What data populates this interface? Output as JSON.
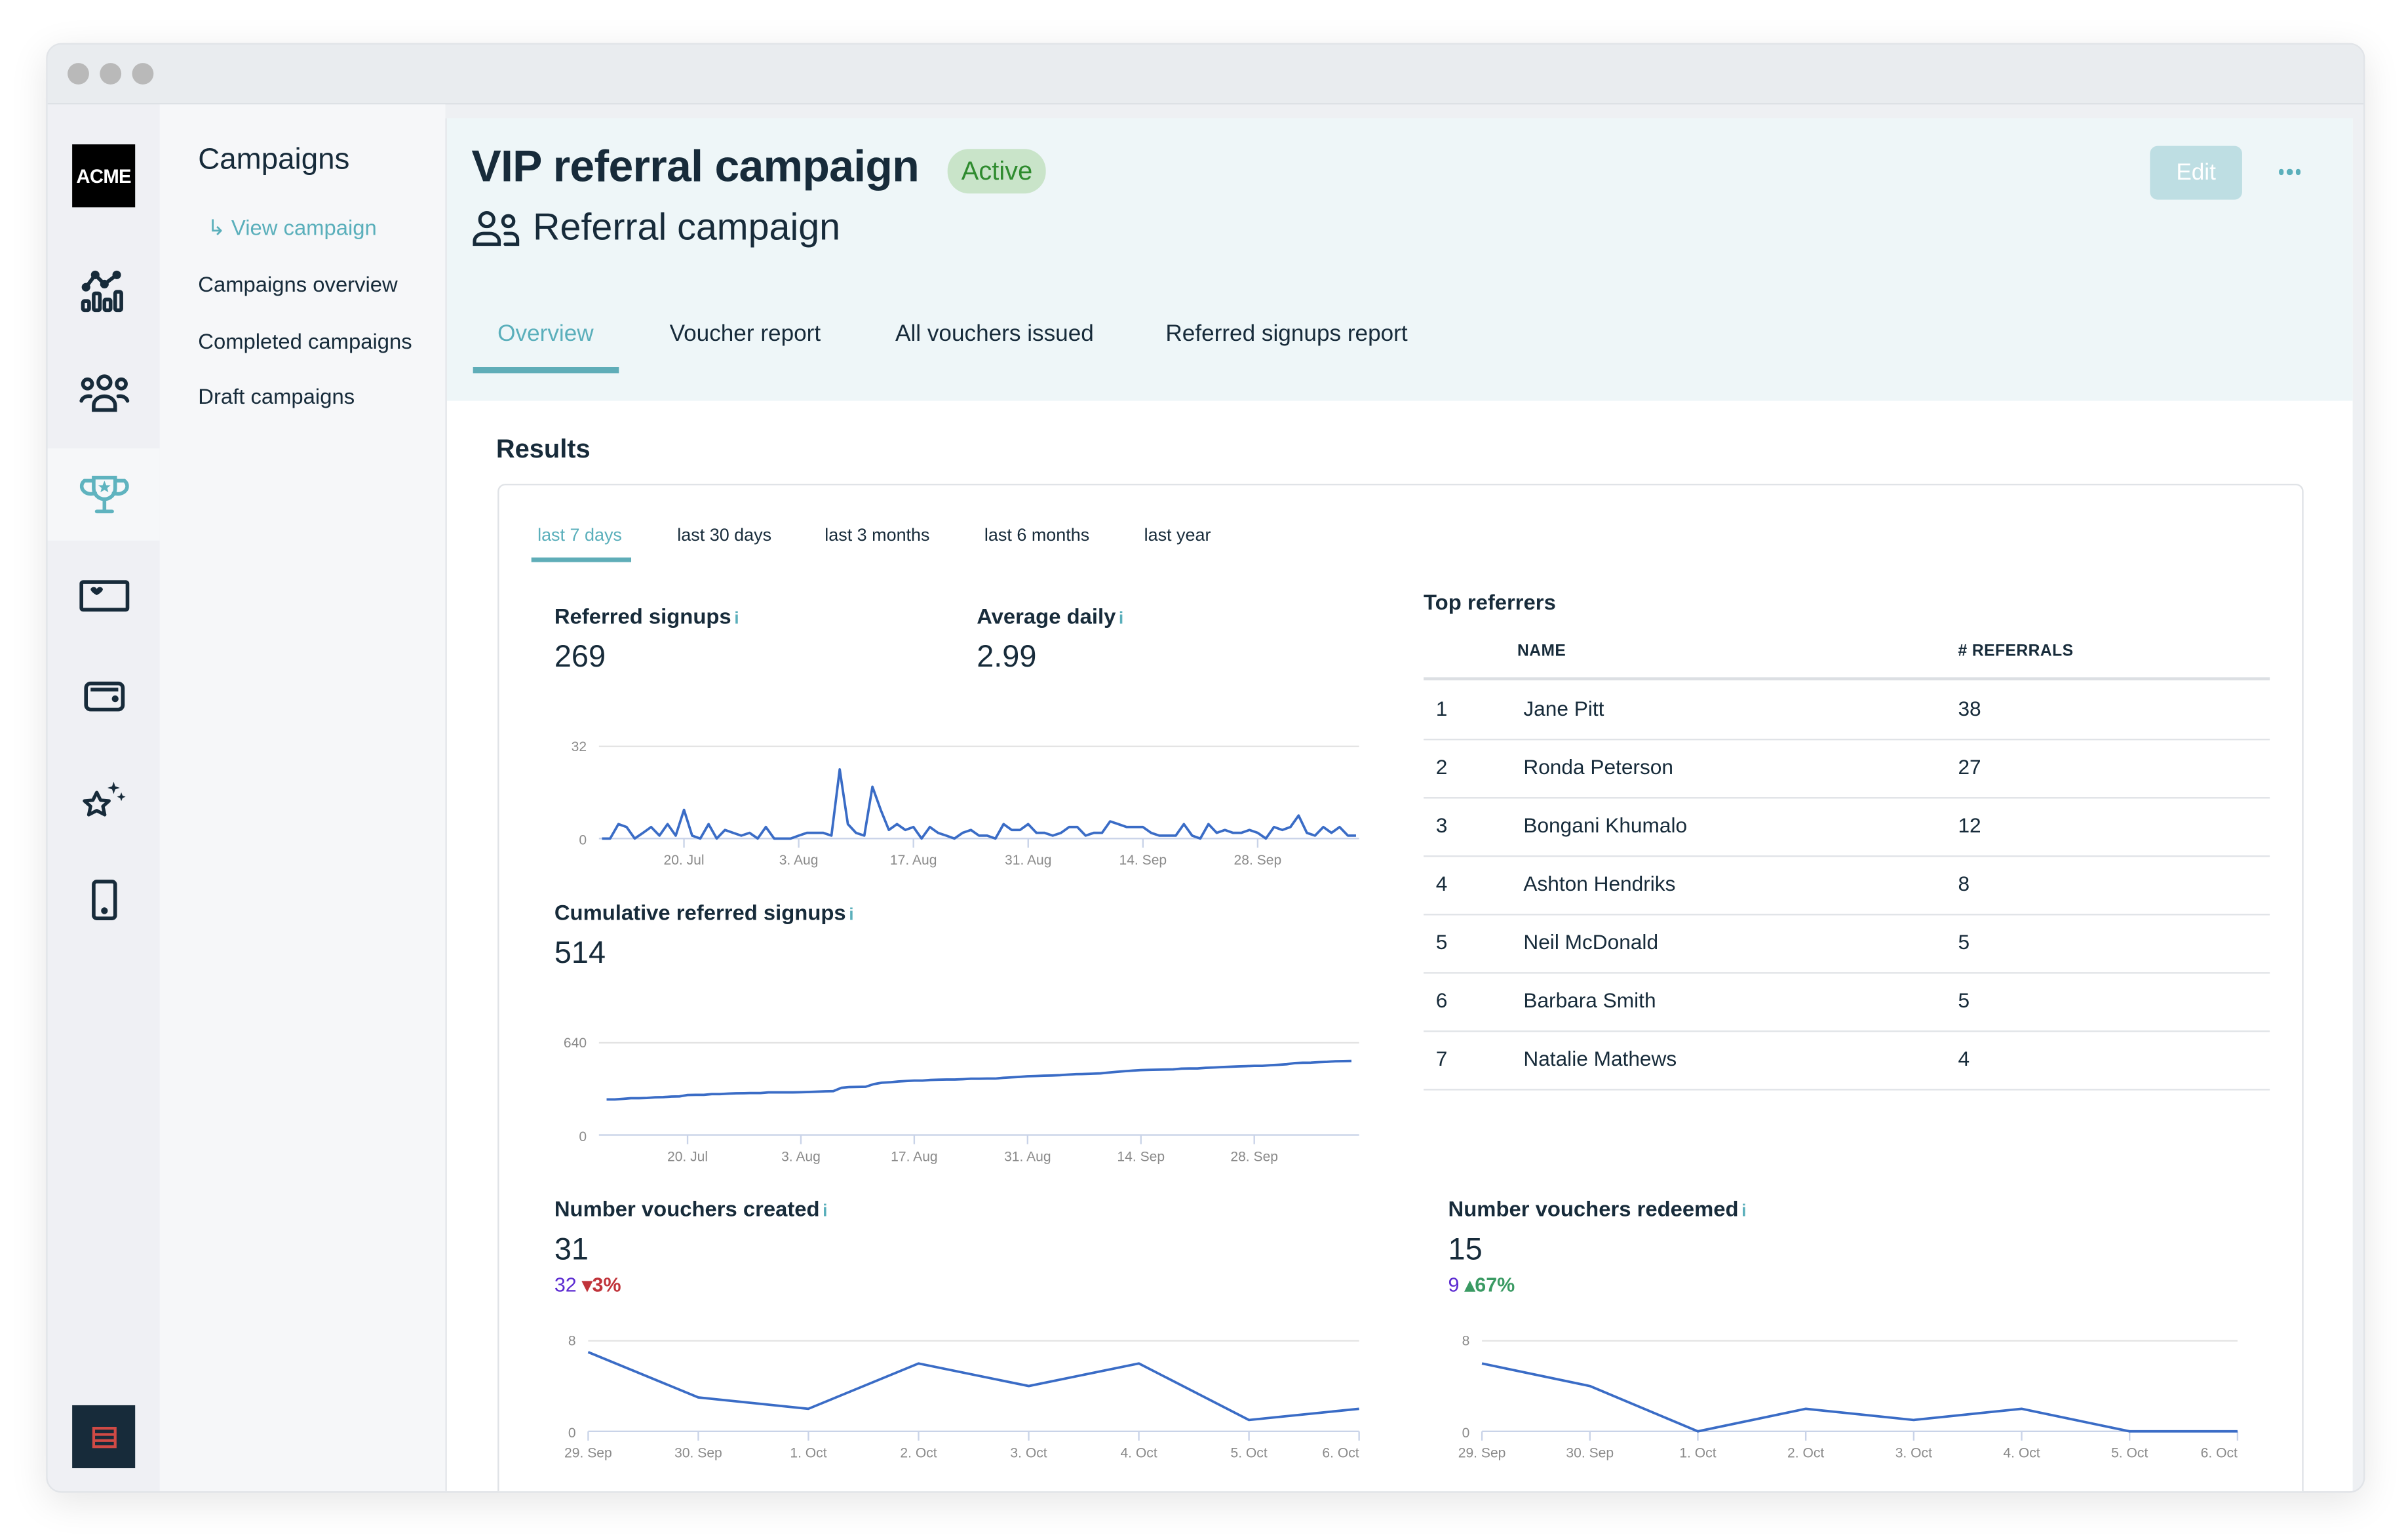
{
  "window": {
    "controls": [
      "close",
      "minimize",
      "maximize"
    ]
  },
  "rail": {
    "logo": "ACME",
    "items": [
      {
        "icon": "analytics-icon",
        "active": false
      },
      {
        "icon": "customers-icon",
        "active": false
      },
      {
        "icon": "trophy-icon",
        "active": true
      },
      {
        "icon": "gift-card-icon",
        "active": false
      },
      {
        "icon": "wallet-icon",
        "active": false
      },
      {
        "icon": "stars-icon",
        "active": false
      },
      {
        "icon": "mobile-icon",
        "active": false
      }
    ],
    "bottom_icon": "menu-icon"
  },
  "subnav": {
    "title": "Campaigns",
    "current": "↳ View campaign",
    "links": [
      "Campaigns overview",
      "Completed campaigns",
      "Draft campaigns"
    ]
  },
  "header": {
    "title": "VIP referral campaign",
    "status": "Active",
    "subtitle": "Referral campaign",
    "edit_label": "Edit",
    "tabs": [
      "Overview",
      "Voucher report",
      "All vouchers issued",
      "Referred signups report"
    ],
    "active_tab": "Overview"
  },
  "results": {
    "heading": "Results",
    "periods": [
      "last 7 days",
      "last 30 days",
      "last 3 months",
      "last 6 months",
      "last year"
    ],
    "active_period": "last 7 days",
    "info_glyph": "i",
    "referred_signups": {
      "label": "Referred signups",
      "value": "269"
    },
    "average_daily": {
      "label": "Average daily",
      "value": "2.99"
    },
    "cumulative": {
      "label": "Cumulative referred signups",
      "value": "514"
    },
    "vouchers_created": {
      "label": "Number vouchers created",
      "value": "31",
      "previous": "32",
      "change": "3%",
      "direction": "down"
    },
    "vouchers_redeemed": {
      "label": "Number vouchers redeemed",
      "value": "15",
      "previous": "9",
      "change": "67%",
      "direction": "up"
    },
    "top_referrers": {
      "title": "Top referrers",
      "columns": [
        "NAME",
        "# REFERRALS"
      ],
      "rows": [
        {
          "rank": "1",
          "name": "Jane Pitt",
          "referrals": "38"
        },
        {
          "rank": "2",
          "name": "Ronda Peterson",
          "referrals": "27"
        },
        {
          "rank": "3",
          "name": "Bongani Khumalo",
          "referrals": "12"
        },
        {
          "rank": "4",
          "name": "Ashton Hendriks",
          "referrals": "8"
        },
        {
          "rank": "5",
          "name": "Neil McDonald",
          "referrals": "5"
        },
        {
          "rank": "6",
          "name": "Barbara Smith",
          "referrals": "5"
        },
        {
          "rank": "7",
          "name": "Natalie Mathews",
          "referrals": "4"
        }
      ]
    }
  },
  "colors": {
    "accent": "#5fadb8",
    "line": "#3a6cc6",
    "active_badge_bg": "#c9e4c9",
    "active_badge_text": "#2e8b2e",
    "down": "#c0333a",
    "up": "#3a9a63",
    "previous": "#5b2ad1"
  },
  "chart_data": [
    {
      "id": "daily_signups",
      "type": "line",
      "title": "Referred signups",
      "xlabel": "",
      "ylabel": "",
      "ylim": [
        0,
        32
      ],
      "yticks": [
        "0",
        "32"
      ],
      "xticks": [
        "20. Jul",
        "3. Aug",
        "17. Aug",
        "31. Aug",
        "14. Sep",
        "28. Sep"
      ],
      "xtick_index": [
        10,
        24,
        38,
        52,
        66,
        80
      ],
      "values": [
        0,
        0,
        5,
        4,
        0,
        2,
        4,
        1,
        5,
        1,
        10,
        1,
        0,
        5,
        0,
        3,
        2,
        1,
        2,
        0,
        4,
        0,
        0,
        0,
        1,
        2,
        2,
        2,
        1,
        24,
        5,
        2,
        1,
        18,
        10,
        3,
        5,
        3,
        4,
        0,
        4,
        2,
        1,
        0,
        2,
        3,
        1,
        1,
        0,
        5,
        3,
        3,
        5,
        2,
        2,
        1,
        2,
        4,
        4,
        1,
        2,
        2,
        6,
        5,
        4,
        4,
        4,
        2,
        1,
        1,
        1,
        5,
        1,
        0,
        5,
        2,
        3,
        2,
        2,
        3,
        2,
        0,
        4,
        3,
        4,
        8,
        2,
        1,
        4,
        2,
        4,
        1,
        1
      ],
      "grid": true
    },
    {
      "id": "cumulative_signups",
      "type": "line",
      "title": "Cumulative referred signups",
      "ylim": [
        0,
        640
      ],
      "yticks": [
        "0",
        "640"
      ],
      "xticks": [
        "20. Jul",
        "3. Aug",
        "17. Aug",
        "31. Aug",
        "14. Sep",
        "28. Sep"
      ],
      "start_value": 246,
      "end_value": 514,
      "grid": true
    },
    {
      "id": "vouchers_created",
      "type": "line",
      "title": "Number vouchers created",
      "categories": [
        "29. Sep",
        "30. Sep",
        "1. Oct",
        "2. Oct",
        "3. Oct",
        "4. Oct",
        "5. Oct",
        "6. Oct"
      ],
      "values": [
        7,
        3,
        2,
        6,
        4,
        6,
        1,
        2
      ],
      "ylim": [
        0,
        8
      ],
      "yticks": [
        "0",
        "8"
      ],
      "grid": true
    },
    {
      "id": "vouchers_redeemed",
      "type": "line",
      "title": "Number vouchers redeemed",
      "categories": [
        "29. Sep",
        "30. Sep",
        "1. Oct",
        "2. Oct",
        "3. Oct",
        "4. Oct",
        "5. Oct",
        "6. Oct"
      ],
      "values": [
        6,
        4,
        0,
        2,
        1,
        2,
        0,
        0
      ],
      "ylim": [
        0,
        8
      ],
      "yticks": [
        "0",
        "8"
      ],
      "grid": true
    }
  ]
}
